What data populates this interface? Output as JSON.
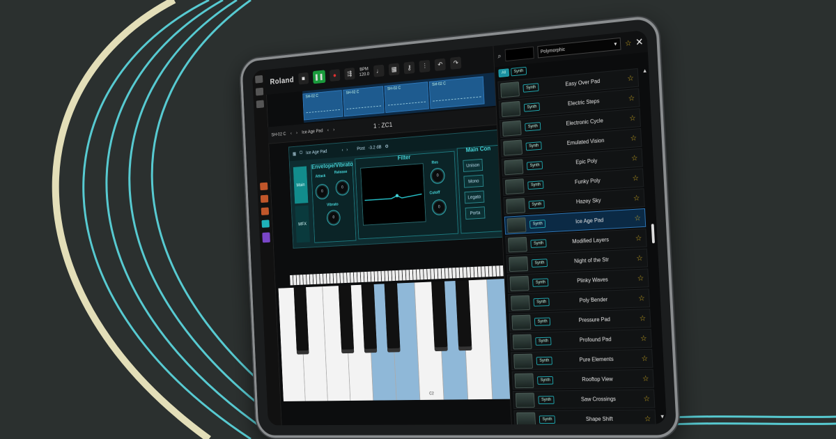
{
  "transport": {
    "brand": "Roland",
    "bpm_label": "BPM",
    "bpm_value": "120.0"
  },
  "clips": [
    "SH-02 C",
    "SH-02 C",
    "SH-02 C",
    "SH-02 C"
  ],
  "instbar": {
    "left_instrument": "SH-02 C",
    "instrument": "Ice Age Pad",
    "zone": "1 : ZC1"
  },
  "panel": {
    "preset": "Ice Age Pad",
    "post_label": "Post",
    "post_value": "-3.2 dB",
    "tabs": [
      "Main",
      "MFX"
    ],
    "env_title": "Envelope/Vibrato",
    "attack_label": "Attack",
    "release_label": "Release",
    "vibrato_label": "Vibrato",
    "attack_value": "0",
    "release_value": "0",
    "vibrato_value": "0",
    "filter_title": "Filter",
    "res_label": "Res",
    "cutoff_label": "Cutoff",
    "res_value": "0",
    "cutoff_value": "0",
    "main_title": "Main Con",
    "main_buttons": [
      "Unison",
      "Mono",
      "Legato",
      "Porta"
    ]
  },
  "keyboard": {
    "c2_label": "C2"
  },
  "browser": {
    "dropdown_value": "Polymorphic",
    "filter_all": "All",
    "filter_synth": "Synth",
    "presets": [
      {
        "name": "Easy Over Pad",
        "tag": "Synth"
      },
      {
        "name": "Electric Steps",
        "tag": "Synth"
      },
      {
        "name": "Electronic Cycle",
        "tag": "Synth"
      },
      {
        "name": "Emulated Vision",
        "tag": "Synth"
      },
      {
        "name": "Epic Poly",
        "tag": "Synth"
      },
      {
        "name": "Funky Poly",
        "tag": "Synth"
      },
      {
        "name": "Hazey Sky",
        "tag": "Synth"
      },
      {
        "name": "Ice Age Pad",
        "tag": "Synth"
      },
      {
        "name": "Modified Layers",
        "tag": "Synth"
      },
      {
        "name": "Night of the Str",
        "tag": "Synth"
      },
      {
        "name": "Plinky Waves",
        "tag": "Synth"
      },
      {
        "name": "Poly Bender",
        "tag": "Synth"
      },
      {
        "name": "Pressure Pad",
        "tag": "Synth"
      },
      {
        "name": "Profound Pad",
        "tag": "Synth"
      },
      {
        "name": "Pure Elements",
        "tag": "Synth"
      },
      {
        "name": "Rooftop View",
        "tag": "Synth"
      },
      {
        "name": "Saw Crossings",
        "tag": "Synth"
      },
      {
        "name": "Shape Shift",
        "tag": "Synth"
      }
    ],
    "selected_index": 7
  },
  "colors": {
    "accent": "#1fb2b9",
    "selected": "#2e77b8",
    "play": "#1a9a3c",
    "star": "#d6b020"
  }
}
